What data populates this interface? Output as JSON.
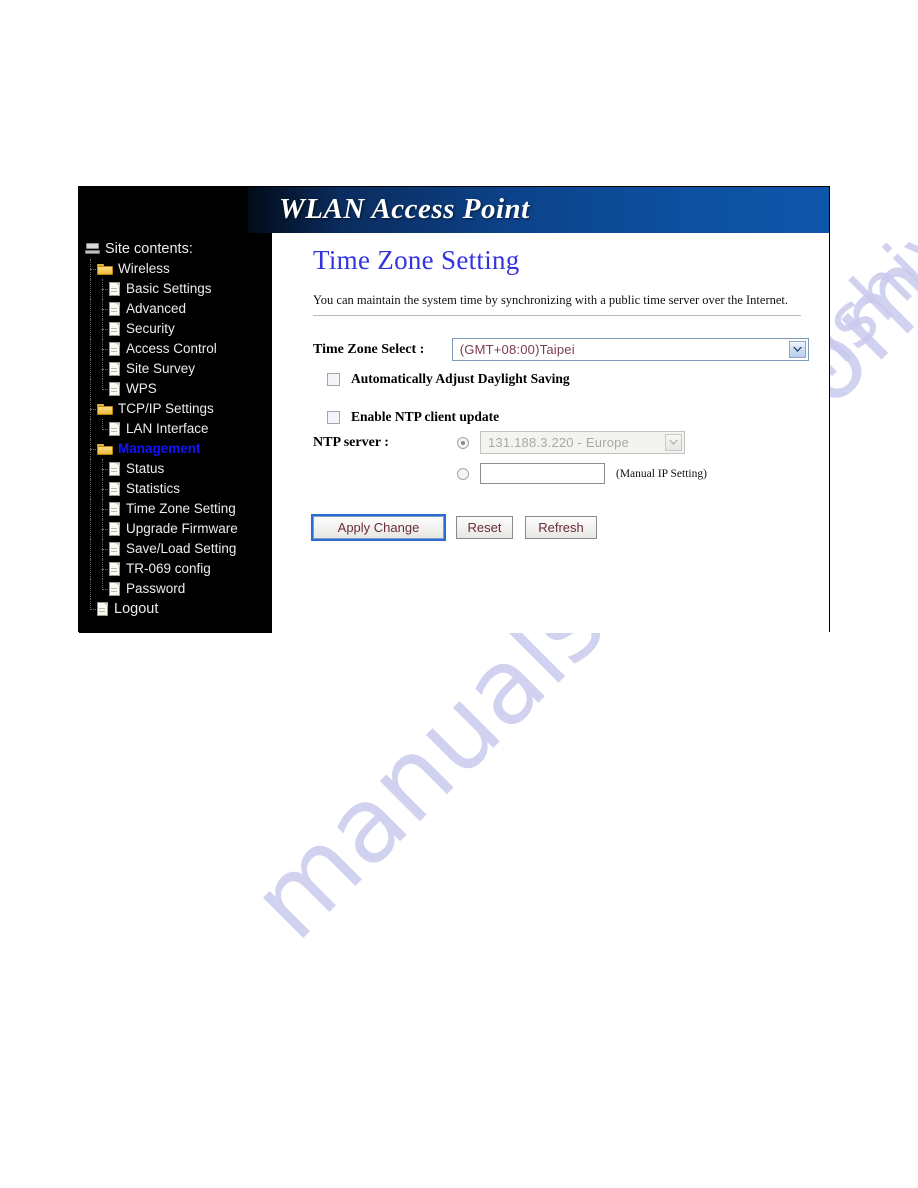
{
  "banner": {
    "title": "WLAN Access Point"
  },
  "sidebar": {
    "root_label": "Site contents:",
    "items": [
      {
        "label": "Wireless",
        "icon": "folder-icon",
        "level": 1,
        "selected": false
      },
      {
        "label": "Basic Settings",
        "icon": "page-icon",
        "level": 2,
        "selected": false
      },
      {
        "label": "Advanced",
        "icon": "page-icon",
        "level": 2,
        "selected": false
      },
      {
        "label": "Security",
        "icon": "page-icon",
        "level": 2,
        "selected": false
      },
      {
        "label": "Access Control",
        "icon": "page-icon",
        "level": 2,
        "selected": false
      },
      {
        "label": "Site Survey",
        "icon": "page-icon",
        "level": 2,
        "selected": false
      },
      {
        "label": "WPS",
        "icon": "page-icon",
        "level": 2,
        "selected": false
      },
      {
        "label": "TCP/IP Settings",
        "icon": "folder-icon",
        "level": 1,
        "selected": false
      },
      {
        "label": "LAN Interface",
        "icon": "page-icon",
        "level": 2,
        "selected": false
      },
      {
        "label": "Management",
        "icon": "folder-icon",
        "level": 1,
        "selected": true
      },
      {
        "label": "Status",
        "icon": "page-icon",
        "level": 2,
        "selected": false
      },
      {
        "label": "Statistics",
        "icon": "page-icon",
        "level": 2,
        "selected": false
      },
      {
        "label": "Time Zone Setting",
        "icon": "page-icon",
        "level": 2,
        "selected": false
      },
      {
        "label": "Upgrade Firmware",
        "icon": "page-icon",
        "level": 2,
        "selected": false
      },
      {
        "label": "Save/Load Setting",
        "icon": "page-icon",
        "level": 2,
        "selected": false
      },
      {
        "label": "TR-069 config",
        "icon": "page-icon",
        "level": 2,
        "selected": false
      },
      {
        "label": "Password",
        "icon": "page-icon",
        "level": 2,
        "selected": false
      },
      {
        "label": "Logout",
        "icon": "page-icon",
        "level": 1,
        "selected": false
      }
    ]
  },
  "main": {
    "title": "Time Zone Setting",
    "description": "You can maintain the system time by synchronizing with a public time server over the Internet.",
    "timezone": {
      "label": "Time Zone Select :",
      "value": "(GMT+08:00)Taipei",
      "arrow_icon": "chevron-down-icon"
    },
    "daylight_saving": {
      "label": "Automatically Adjust Daylight Saving",
      "checked": false
    },
    "ntp_enable": {
      "label": "Enable NTP client update",
      "checked": false
    },
    "ntp_server": {
      "label": "NTP server :",
      "preset_value": "131.188.3.220 - Europe",
      "preset_selected": true,
      "preset_disabled": true,
      "manual_value": "",
      "manual_placeholder": "",
      "manual_selected": false,
      "manual_note": "(Manual IP Setting)",
      "arrow_icon": "chevron-down-icon"
    },
    "buttons": {
      "apply": "Apply Change",
      "reset": "Reset",
      "refresh": "Refresh"
    }
  },
  "watermark": {
    "text_large": "manualshive.com",
    "text_small": "manualshive.com",
    "color": "#c9c9ee"
  }
}
